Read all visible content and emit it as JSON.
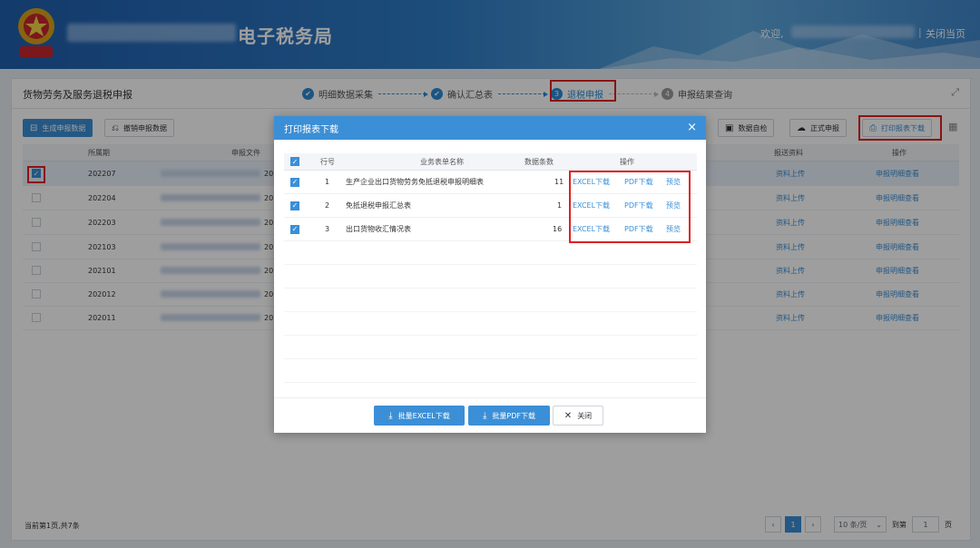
{
  "header": {
    "title": "电子税务局",
    "welcome": "欢迎,",
    "close_page": "关闭当页"
  },
  "page": {
    "title": "货物劳务及服务退税申报",
    "steps": [
      {
        "number": "✔",
        "label": "明细数据采集",
        "state": "done"
      },
      {
        "number": "✔",
        "label": "确认汇总表",
        "state": "done"
      },
      {
        "number": "3",
        "label": "退税申报",
        "state": "active"
      },
      {
        "number": "4",
        "label": "申报结果查询",
        "state": "pending"
      }
    ]
  },
  "toolbar": {
    "generate": "生成申报数据",
    "revoke": "撤销申报数据",
    "data_check": "数据自检",
    "formal_declare": "正式申报",
    "print_download": "打印报表下载"
  },
  "table": {
    "headers": {
      "period": "所属期",
      "file": "申报文件",
      "upload": "报送资料",
      "action": "操作"
    },
    "rows": [
      {
        "period": "202207",
        "file_suffix": "20",
        "checked": true,
        "upload": "资料上传",
        "action": "申报明细查看"
      },
      {
        "period": "202204",
        "file_suffix": "20",
        "checked": false,
        "upload": "资料上传",
        "action": "申报明细查看"
      },
      {
        "period": "202203",
        "file_suffix": "20",
        "checked": false,
        "upload": "资料上传",
        "action": "申报明细查看"
      },
      {
        "period": "202103",
        "file_suffix": "20",
        "checked": false,
        "upload": "资料上传",
        "action": "申报明细查看"
      },
      {
        "period": "202101",
        "file_suffix": "20",
        "checked": false,
        "upload": "资料上传",
        "action": "申报明细查看"
      },
      {
        "period": "202012",
        "file_suffix": "20",
        "checked": false,
        "upload": "资料上传",
        "action": "申报明细查看"
      },
      {
        "period": "202011",
        "file_suffix": "20",
        "checked": false,
        "upload": "资料上传",
        "action": "申报明细查看"
      }
    ]
  },
  "footer": {
    "info": "当前第1页,共7条",
    "current_page": "1",
    "page_size": "10 条/页",
    "goto_label": "到第",
    "goto_value": "1",
    "page_unit": "页"
  },
  "dialog": {
    "title": "打印报表下载",
    "headers": {
      "row": "行号",
      "name": "业务表单名称",
      "count": "数据条数",
      "ops": "操作"
    },
    "rows": [
      {
        "row": "1",
        "name": "生产企业出口货物劳务免抵退税申报明细表",
        "count": "11",
        "excel": "EXCEL下载",
        "pdf": "PDF下载",
        "preview": "预览"
      },
      {
        "row": "2",
        "name": "免抵退税申报汇总表",
        "count": "1",
        "excel": "EXCEL下载",
        "pdf": "PDF下载",
        "preview": "预览"
      },
      {
        "row": "3",
        "name": "出口货物收汇情况表",
        "count": "16",
        "excel": "EXCEL下载",
        "pdf": "PDF下载",
        "preview": "预览"
      }
    ],
    "batch_excel": "批量EXCEL下载",
    "batch_pdf": "批量PDF下载",
    "close": "关闭"
  },
  "icons": {
    "emblem": "tax-emblem-icon",
    "check": "check-icon",
    "close": "close-icon",
    "expand": "expand-icon",
    "print": "print-icon",
    "download": "download-icon"
  },
  "colors": {
    "primary": "#3b8fd6",
    "header": "#2f7cc6",
    "highlight": "#e02020"
  }
}
